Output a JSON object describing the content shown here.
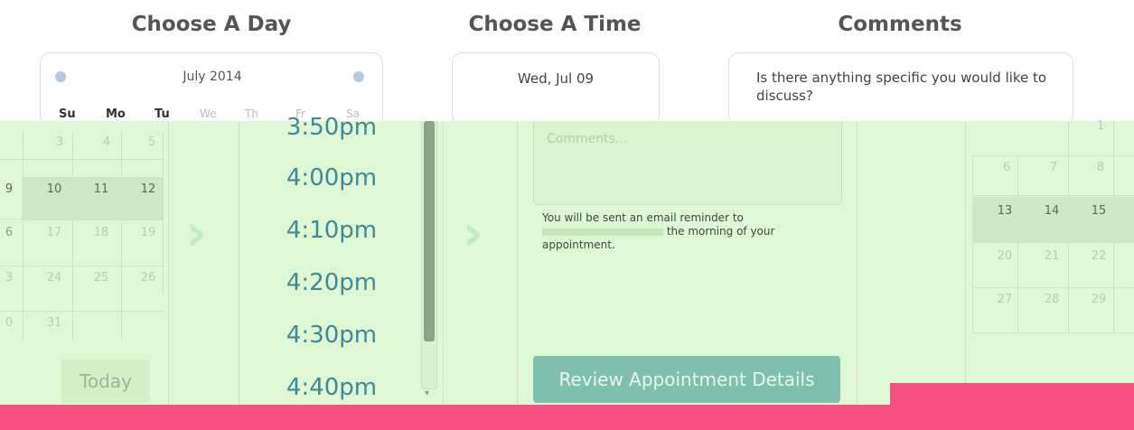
{
  "headings": {
    "day": "Choose A Day",
    "time": "Choose A Time",
    "comments": "Comments"
  },
  "calendar": {
    "month": "July 2014",
    "weekdays": [
      "Su",
      "Mo",
      "Tu",
      "We",
      "Th",
      "Fr",
      "Sa"
    ],
    "today_label": "Today"
  },
  "left_grid_days": {
    "r1": [
      "3",
      "4",
      "5"
    ],
    "r2": [
      "9",
      "10",
      "11",
      "12"
    ],
    "r3": [
      "6",
      "17",
      "18",
      "19"
    ],
    "r4": [
      "3",
      "24",
      "25",
      "26"
    ],
    "r5": [
      "0",
      "31"
    ]
  },
  "right_grid_days": {
    "r0": [
      "1"
    ],
    "r1": [
      "6",
      "7",
      "8"
    ],
    "r2": [
      "13",
      "14",
      "15"
    ],
    "r3": [
      "20",
      "21",
      "22"
    ],
    "r4": [
      "27",
      "28",
      "29"
    ]
  },
  "time_picker": {
    "selected_date": "Wed, Jul 09",
    "times": [
      "3:50pm",
      "4:00pm",
      "4:10pm",
      "4:20pm",
      "4:30pm",
      "4:40pm"
    ],
    "scroll_down_glyph": "▾"
  },
  "comments": {
    "prompt": "Is there anything specific you would like to discuss?",
    "placeholder": "Comments...",
    "reminder_line1": "You will be sent an email reminder to",
    "reminder_line2_suffix": "the morning of your",
    "reminder_line3": "appointment.",
    "review_button": "Review Appointment Details"
  },
  "colors": {
    "green_panel": "#def7d4",
    "pink_band": "#f5507f",
    "time_text": "#3f8a94",
    "review_button": "#7fbfae"
  }
}
